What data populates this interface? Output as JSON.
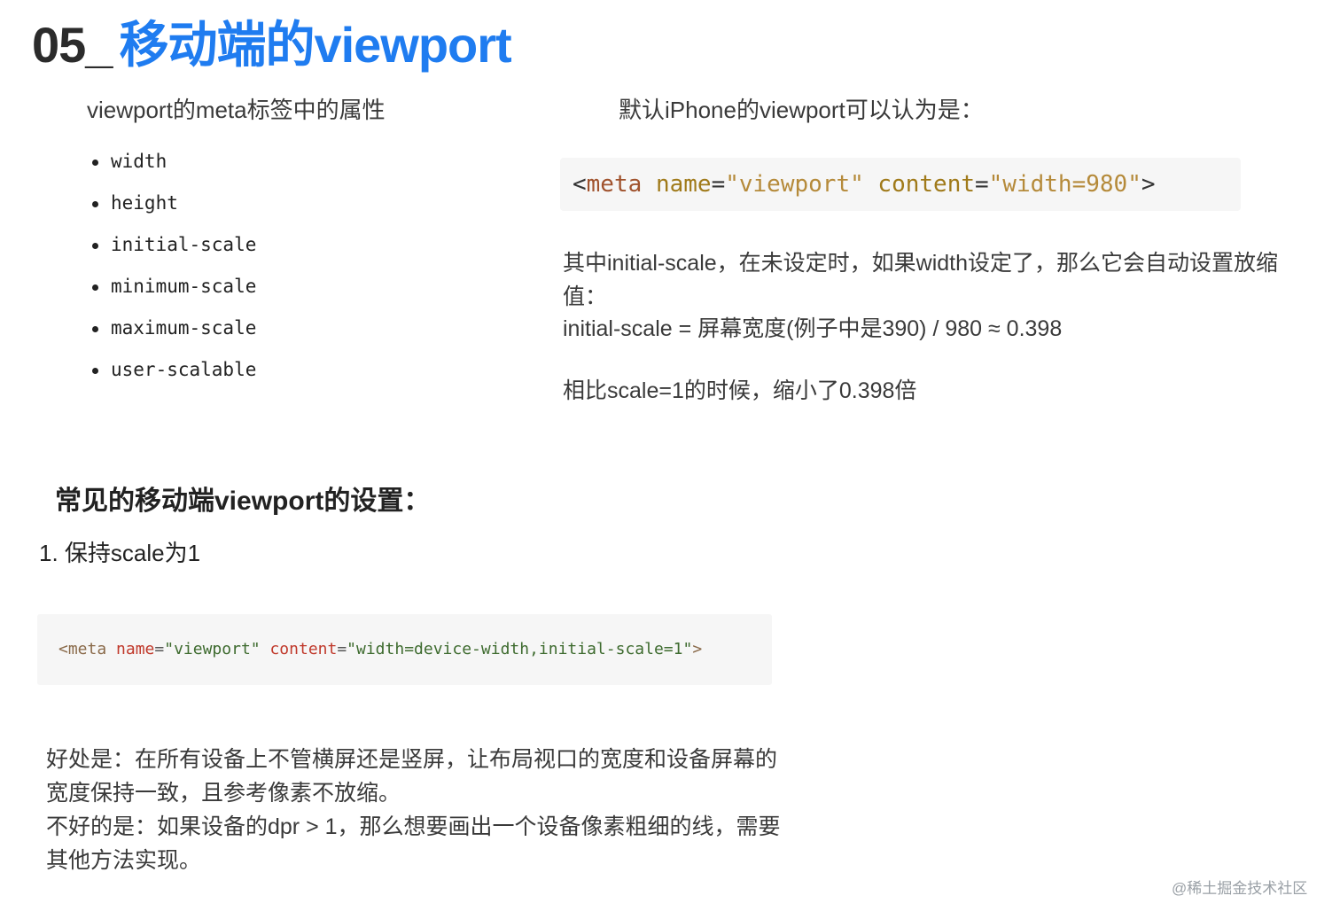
{
  "slide": {
    "title_num": "05_",
    "title_text": "移动端的viewport",
    "left_heading": "viewport的meta标签中的属性",
    "properties": [
      "width",
      "height",
      "initial-scale",
      "minimum-scale",
      "maximum-scale",
      "user-scalable"
    ],
    "right_heading": "默认iPhone的viewport可以认为是：",
    "code_default": {
      "open": "<",
      "tag": "meta",
      "attr1": "name",
      "eq": "=",
      "val1": "\"viewport\"",
      "attr2": "content",
      "val2": "\"width=980\"",
      "close": ">"
    },
    "explain_1": "其中initial-scale，在未设定时，如果width设定了，那么它会自动设置放缩值：",
    "explain_2": "initial-scale = 屏幕宽度(例子中是390) / 980 ≈ 0.398",
    "explain_3": "相比scale=1的时候，缩小了0.398倍",
    "common_heading": "常见的移动端viewport的设置：",
    "item_1": "1. 保持scale为1",
    "code_common": {
      "open": "<",
      "tag": "meta",
      "attr1": "name",
      "eq": "=",
      "val1": "\"viewport\"",
      "attr2": "content",
      "val2": "\"width=device-width,initial-scale=1\"",
      "close": ">"
    },
    "benefit_1": "好处是：在所有设备上不管横屏还是竖屏，让布局视口的宽度和设备屏幕的宽度保持一致，且参考像素不放缩。",
    "benefit_2": "不好的是：如果设备的dpr > 1，那么想要画出一个设备像素粗细的线，需要其他方法实现。",
    "watermark": "@稀土掘金技术社区"
  }
}
